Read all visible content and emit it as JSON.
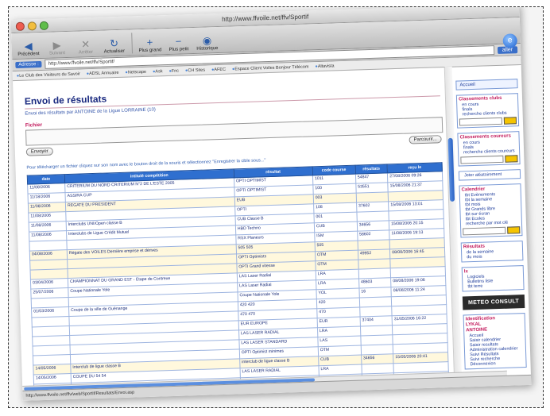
{
  "window": {
    "title": "http://www.ffvoile.net/ffv/Sportif"
  },
  "toolbar": {
    "buttons": [
      {
        "label": "Précédent",
        "icon": "back-arrow-icon",
        "icon_char": "◀",
        "dim": false
      },
      {
        "label": "Suivant",
        "icon": "forward-arrow-icon",
        "icon_char": "▶",
        "dim": true
      },
      {
        "label": "Arrêter",
        "icon": "stop-icon",
        "icon_char": "✕",
        "dim": true
      },
      {
        "label": "Actualiser",
        "icon": "refresh-icon",
        "icon_char": "↻",
        "dim": false
      },
      {
        "label": "Plus grand",
        "icon": "plus-icon",
        "icon_char": "+",
        "dim": false
      },
      {
        "label": "Plus petit",
        "icon": "minus-icon",
        "icon_char": "−",
        "dim": false
      },
      {
        "label": "Historique",
        "icon": "history-icon",
        "icon_char": "◉",
        "dim": false
      }
    ]
  },
  "addressbar": {
    "label": "Adresse :",
    "url": "http://www.ffvoile.net/ffv/Sportif/",
    "go": "aller"
  },
  "bookmarks": [
    "Le Club des Visiteurs du Savoir",
    "ADSL Annuaire",
    "Netscape",
    "Ask",
    "Fnc",
    "CH Sites",
    "AFEC",
    "Espace Client Voiles Bonjour Télécom",
    "Altavista"
  ],
  "page": {
    "title": "Envoi de résultats",
    "subline": "Envoi des résultats par ANTOINE de la Ligue LORRAINE (10)",
    "fichier_label": "Fichier",
    "browse_button": "Parcourir...",
    "submit_button": "Envoyer",
    "instructions": "Pour télécharger un fichier cliquez sur son nom avec le bouton droit de la souris et sélectionnez \"Enregistrer la cible sous...\""
  },
  "table": {
    "headers": [
      "date",
      "intitulé compétition",
      "résultat",
      "code course",
      "résultats",
      "reçu le"
    ],
    "rows": [
      {
        "date": "11/08/2006",
        "title": "CRITERIUM DU NORD CRITERIUM N°2 DE L'ESTE 2005",
        "result": "OPTI OPTIMIST",
        "code": "1011",
        "n": "54847",
        "received": "27/08/2006 09:26",
        "alt": false
      },
      {
        "date": "11/18/2006",
        "title": "ASSIRA CUP",
        "result": "OPTI OPTIMIST",
        "code": "100",
        "n": "53551",
        "received": "15/08/2006 21:37",
        "alt": false
      },
      {
        "date": "11/08/2006",
        "title": "REGATE DU PRESIDENT",
        "result": "EUB",
        "code": "003",
        "n": "",
        "received": "",
        "alt": true
      },
      {
        "date": "11/08/2006",
        "title": "",
        "result": "OPTI",
        "code": "108",
        "n": "37602",
        "received": "15/08/2006 13:01",
        "alt": false
      },
      {
        "date": "11/08/2006",
        "title": "Interclubs UNI/Open classe B",
        "result": "CUB Classe B",
        "code": "001",
        "n": "",
        "received": "",
        "alt": false
      },
      {
        "date": "11/08/2006",
        "title": "Interclubs de Ligue Crédit Mutuel",
        "result": "HBD Techno",
        "code": "CUB",
        "n": "34656",
        "received": "15/08/2006 20:15",
        "alt": false
      },
      {
        "date": "",
        "title": "",
        "result": "RSX Planeurs",
        "code": "ISM",
        "n": "58602",
        "received": "11/08/2006 19:13",
        "alt": false
      },
      {
        "date": "04/08/2006",
        "title": "Régate des VOILES Dernière emprise et dérives",
        "result": "505 505",
        "code": "505",
        "n": "",
        "received": "",
        "alt": true
      },
      {
        "date": "",
        "title": "",
        "result": "OPTI Optimists",
        "code": "OTM",
        "n": "49952",
        "received": "08/08/2006 16:45",
        "alt": true
      },
      {
        "date": "",
        "title": "",
        "result": "OPTI Grand vitesse",
        "code": "OTM",
        "n": "",
        "received": "",
        "alt": true
      },
      {
        "date": "03/04/2006",
        "title": "CHAMPIONNAT DU GRAND EST - Etape de Contrexe",
        "result": "LAS Laser Radial",
        "code": "LRA",
        "n": "",
        "received": "",
        "alt": false
      },
      {
        "date": "25/07/2006",
        "title": "Coupe Nationale Yole",
        "result": "LAS Laser Radial",
        "code": "LRA",
        "n": "48603",
        "received": "08/08/2006 19:06",
        "alt": false
      },
      {
        "date": "",
        "title": "",
        "result": "Coupe Nationale Yole",
        "code": "YOL",
        "n": "16",
        "received": "08/08/2006 11:24",
        "alt": false
      },
      {
        "date": "01/03/2006",
        "title": "Coupe de la ville de Guénange",
        "result": "420 420",
        "code": "420",
        "n": "",
        "received": "",
        "alt": false
      },
      {
        "date": "",
        "title": "",
        "result": "470 470",
        "code": "470",
        "n": "",
        "received": "",
        "alt": false
      },
      {
        "date": "",
        "title": "",
        "result": "EUR EUROPE",
        "code": "EUR",
        "n": "37404",
        "received": "31/05/2006 16:22",
        "alt": false
      },
      {
        "date": "",
        "title": "",
        "result": "LAS LASER RADIAL",
        "code": "LRA",
        "n": "",
        "received": "",
        "alt": false
      },
      {
        "date": "",
        "title": "",
        "result": "LAS LASER STANDARD",
        "code": "LAS",
        "n": "",
        "received": "",
        "alt": false
      },
      {
        "date": "",
        "title": "",
        "result": "OPTI Optimist minimes",
        "code": "OTM",
        "n": "",
        "received": "",
        "alt": false
      },
      {
        "date": "14/05/2006",
        "title": "Interclub de ligue classe B",
        "result": "interclub de ligue classe B",
        "code": "CUB",
        "n": "34656",
        "received": "15/05/2006 20:41",
        "alt": true
      },
      {
        "date": "14/05/2006",
        "title": "COUPE DU 54 54",
        "result": "LAS LASER RADIAL",
        "code": "LRA",
        "n": "",
        "received": "",
        "alt": false
      },
      {
        "date": "",
        "title": "",
        "result": "LAS LASER STANDARD",
        "code": "LAS",
        "n": "",
        "received": "",
        "alt": false
      },
      {
        "date": "",
        "title": "",
        "result": "OPTI OPTIMIST minimes",
        "code": "OTM",
        "n": "34657",
        "received": "15/05/2006 22:11",
        "alt": false
      }
    ]
  },
  "sidebar": {
    "accueil": "Accueil",
    "boxes": [
      {
        "title": "Classements clubs",
        "links": [
          "en cours",
          "finals"
        ],
        "search": "recherche clients clubs"
      },
      {
        "title": "Classements coureurs",
        "links": [
          "en cours",
          "finals"
        ],
        "search": "recherche clients coureurs"
      },
      {
        "title": "",
        "links": [
          "Jeter aléatoirement"
        ],
        "search": ""
      },
      {
        "title": "Calendrier",
        "links": [
          "tbt Evènements",
          "tbt la semaine",
          "tbt mois",
          "tbt Grands libre",
          "tbt sur écran",
          "tbt Ecoles"
        ],
        "search": "recherche par mot clé"
      },
      {
        "title": "Résultats",
        "links": [
          "de la semaine",
          "du mois"
        ],
        "search": ""
      },
      {
        "title": "Ix",
        "links": [
          "Logiciels",
          "Bulletins liste",
          "tbt terre"
        ],
        "search": ""
      }
    ],
    "promo": "METEO CONSULT",
    "identification": {
      "title": "Identification",
      "user_lines": [
        "LYKAL",
        "ANTOINE"
      ],
      "links": [
        "Accueil",
        "Saisir calendrier",
        "Saisir resultats",
        "Administration calendrier",
        "Suivi Résultats",
        "Suivi recherche",
        "Déconnexion"
      ]
    }
  },
  "statusbar": {
    "text": "http://www.ffvoile.net/ffv/web/Sportif/Resultats/Envoi.asp"
  }
}
